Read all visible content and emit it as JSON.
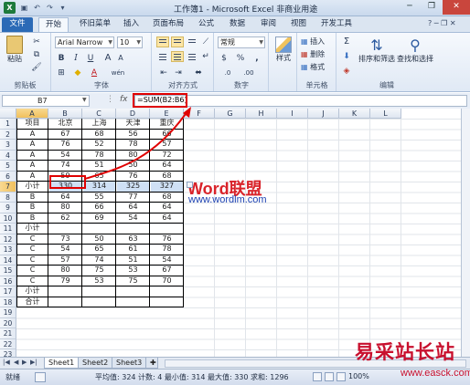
{
  "window": {
    "title": "工作簿1 - Microsoft Excel 非商业用途",
    "app_icon": "X"
  },
  "tabs": [
    "文件",
    "开始",
    "怀旧菜单",
    "插入",
    "页面布局",
    "公式",
    "数据",
    "审阅",
    "视图",
    "开发工具"
  ],
  "ribbon": {
    "clipboard": {
      "paste": "粘贴",
      "label": "剪贴板"
    },
    "font": {
      "name": "Arial Narrow",
      "size": "10",
      "label": "字体",
      "bold": "B",
      "italic": "I",
      "underline": "U",
      "font_color": "A",
      "grow": "A",
      "shrink": "A",
      "phonetic": "wén"
    },
    "alignment": {
      "label": "对齐方式"
    },
    "number": {
      "format": "常规",
      "label": "数字",
      "currency": "$",
      "percent": "%",
      "comma": ",",
      "inc_decimal": ".0",
      "dec_decimal": ".00"
    },
    "styles": {
      "label": "样式",
      "name": "样式"
    },
    "cells": {
      "insert": "插入",
      "delete": "删除",
      "format": "格式",
      "label": "单元格"
    },
    "editing": {
      "sigma": "Σ",
      "sort_filter": "排序和筛选",
      "find_select": "查找和选择",
      "label": "编辑"
    }
  },
  "formula_bar": {
    "name_box": "B7",
    "fx": "fx",
    "formula": "=SUM(B2:B6)"
  },
  "columns": [
    "A",
    "B",
    "C",
    "D",
    "E",
    "F",
    "G",
    "H",
    "I",
    "J",
    "K",
    "L"
  ],
  "rows": [
    [
      "项目",
      "北京",
      "上海",
      "天津",
      "重庆"
    ],
    [
      "A",
      "67",
      "68",
      "56",
      "66"
    ],
    [
      "A",
      "76",
      "52",
      "78",
      "57"
    ],
    [
      "A",
      "54",
      "78",
      "80",
      "72"
    ],
    [
      "A",
      "74",
      "51",
      "50",
      "64"
    ],
    [
      "A",
      "59",
      "65",
      "76",
      "68"
    ],
    [
      "小计",
      "330",
      "314",
      "325",
      "327"
    ],
    [
      "B",
      "64",
      "55",
      "77",
      "68"
    ],
    [
      "B",
      "80",
      "66",
      "64",
      "64"
    ],
    [
      "B",
      "62",
      "69",
      "54",
      "64"
    ],
    [
      "小计",
      "",
      "",
      "",
      ""
    ],
    [
      "C",
      "73",
      "50",
      "63",
      "76"
    ],
    [
      "C",
      "54",
      "65",
      "61",
      "78"
    ],
    [
      "C",
      "57",
      "74",
      "51",
      "54"
    ],
    [
      "C",
      "80",
      "75",
      "53",
      "67"
    ],
    [
      "C",
      "79",
      "53",
      "75",
      "70"
    ],
    [
      "小计",
      "",
      "",
      "",
      ""
    ],
    [
      "合计",
      "",
      "",
      "",
      ""
    ],
    [
      "",
      "",
      "",
      "",
      ""
    ],
    [
      "",
      "",
      "",
      "",
      ""
    ],
    [
      "",
      "",
      "",
      "",
      ""
    ],
    [
      "",
      "",
      "",
      "",
      ""
    ],
    [
      "",
      "",
      "",
      "",
      ""
    ],
    [
      "",
      "",
      "",
      "",
      ""
    ]
  ],
  "selected_cell": "B7",
  "overlay": {
    "brand_word": "Word",
    "brand_cn": "联盟",
    "brand_url": "www.wordlm.com"
  },
  "sheets": [
    "Sheet1",
    "Sheet2",
    "Sheet3"
  ],
  "status": {
    "ready": "就绪",
    "stats": "平均值: 324   计数: 4   最小值: 314   最大值: 330   求和: 1296",
    "zoom": "100%"
  },
  "watermark": {
    "text": "易采站长站",
    "url": "www.easck.com"
  },
  "colors": {
    "accent": "#2b6ab6",
    "red_annotation": "#e00000",
    "selection": "#cfe0f5",
    "excel_green": "#1e7a3c"
  }
}
